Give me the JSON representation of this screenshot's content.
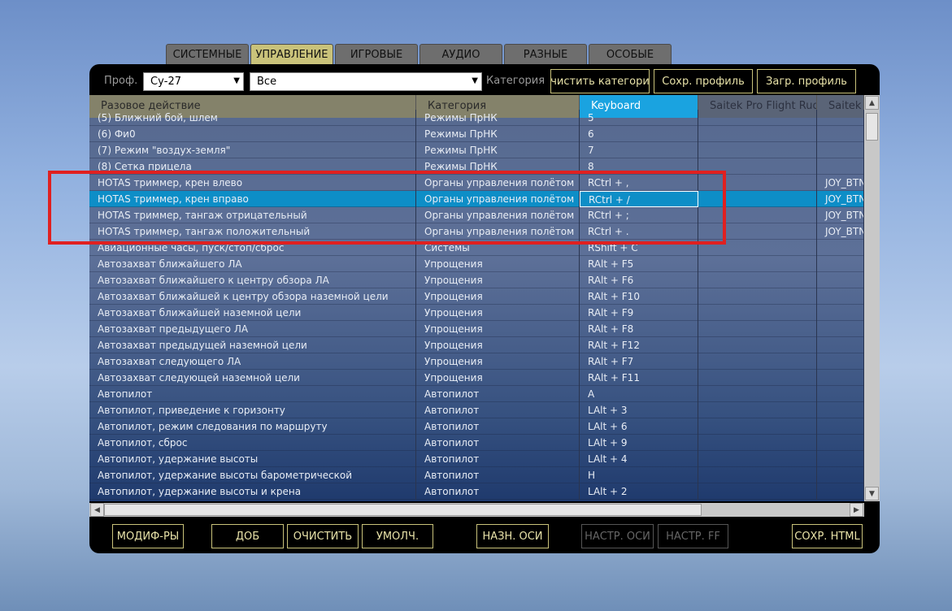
{
  "tabs": [
    "СИСТЕМНЫЕ",
    "УПРАВЛЕНИЕ",
    "ИГРОВЫЕ",
    "АУДИО",
    "РАЗНЫЕ",
    "ОСОБЫЕ"
  ],
  "toolbar": {
    "profile_label": "Проф.",
    "profile_value": "Су-27",
    "filter_value": "Все",
    "category_label": "Категория",
    "clear_category": "чистить категори",
    "save_profile": "Сохр. профиль",
    "load_profile": "Загр. профиль"
  },
  "columns": [
    "Разовое действие",
    "Категория",
    "Keyboard",
    "Saitek Pro Flight Rud",
    "Saitek"
  ],
  "rows": [
    {
      "action": "(5) Ближний бой, шлем",
      "category": "Режимы ПрНК",
      "kb": "5",
      "dev1": "",
      "dev2": ""
    },
    {
      "action": "(6) Фи0",
      "category": "Режимы ПрНК",
      "kb": "6",
      "dev1": "",
      "dev2": ""
    },
    {
      "action": "(7) Режим \"воздух-земля\"",
      "category": "Режимы ПрНК",
      "kb": "7",
      "dev1": "",
      "dev2": ""
    },
    {
      "action": "(8) Сетка прицела",
      "category": "Режимы ПрНК",
      "kb": "8",
      "dev1": "",
      "dev2": ""
    },
    {
      "action": "HOTAS триммер, крен влево",
      "category": "Органы управления полётом",
      "kb": "RCtrl + ,",
      "dev1": "",
      "dev2": "JOY_BTN_"
    },
    {
      "action": "HOTAS триммер, крен вправо",
      "category": "Органы управления полётом",
      "kb": "RCtrl + /",
      "dev1": "",
      "dev2": "JOY_BTN_"
    },
    {
      "action": "HOTAS триммер, тангаж отрицательный",
      "category": "Органы управления полётом",
      "kb": "RCtrl + ;",
      "dev1": "",
      "dev2": "JOY_BTN_"
    },
    {
      "action": "HOTAS триммер, тангаж положительный",
      "category": "Органы управления полётом",
      "kb": "RCtrl + .",
      "dev1": "",
      "dev2": "JOY_BTN_"
    },
    {
      "action": "Авиационные часы, пуск/стоп/сброс",
      "category": "Системы",
      "kb": "RShift + C",
      "dev1": "",
      "dev2": ""
    },
    {
      "action": "Автозахват ближайшего ЛА",
      "category": "Упрощения",
      "kb": "RAlt + F5",
      "dev1": "",
      "dev2": ""
    },
    {
      "action": "Автозахват ближайшего к центру обзора ЛА",
      "category": "Упрощения",
      "kb": "RAlt + F6",
      "dev1": "",
      "dev2": ""
    },
    {
      "action": "Автозахват ближайшей к центру обзора наземной цели",
      "category": "Упрощения",
      "kb": "RAlt + F10",
      "dev1": "",
      "dev2": ""
    },
    {
      "action": "Автозахват ближайшей наземной цели",
      "category": "Упрощения",
      "kb": "RAlt + F9",
      "dev1": "",
      "dev2": ""
    },
    {
      "action": "Автозахват предыдущего ЛА",
      "category": "Упрощения",
      "kb": "RAlt + F8",
      "dev1": "",
      "dev2": ""
    },
    {
      "action": "Автозахват предыдущей наземной цели",
      "category": "Упрощения",
      "kb": "RAlt + F12",
      "dev1": "",
      "dev2": ""
    },
    {
      "action": "Автозахват следующего ЛА",
      "category": "Упрощения",
      "kb": "RAlt + F7",
      "dev1": "",
      "dev2": ""
    },
    {
      "action": "Автозахват следующей наземной цели",
      "category": "Упрощения",
      "kb": "RAlt + F11",
      "dev1": "",
      "dev2": ""
    },
    {
      "action": "Автопилот",
      "category": "Автопилот",
      "kb": "A",
      "dev1": "",
      "dev2": ""
    },
    {
      "action": "Автопилот, приведение к горизонту",
      "category": "Автопилот",
      "kb": "LAlt + 3",
      "dev1": "",
      "dev2": ""
    },
    {
      "action": "Автопилот, режим следования по маршруту",
      "category": "Автопилот",
      "kb": "LAlt + 6",
      "dev1": "",
      "dev2": ""
    },
    {
      "action": "Автопилот, сброс",
      "category": "Автопилот",
      "kb": "LAlt + 9",
      "dev1": "",
      "dev2": ""
    },
    {
      "action": "Автопилот, удержание высоты",
      "category": "Автопилот",
      "kb": "LAlt + 4",
      "dev1": "",
      "dev2": ""
    },
    {
      "action": "Автопилот, удержание высоты барометрической",
      "category": "Автопилот",
      "kb": "H",
      "dev1": "",
      "dev2": ""
    },
    {
      "action": "Автопилот, удержание высоты и крена",
      "category": "Автопилот",
      "kb": "LAlt + 2",
      "dev1": "",
      "dev2": ""
    }
  ],
  "selected_row": 5,
  "bottom_buttons": {
    "modifiers": "МОДИФ-РЫ",
    "add": "ДОБ",
    "clear": "ОЧИСТИТЬ",
    "default": "УМОЛЧ.",
    "assign_axis": "НАЗН. ОСИ",
    "axis_setup": "НАСТР. ОСИ",
    "ff_setup": "НАСТР. FF",
    "save_html": "СОХР. HTML"
  },
  "colors": {
    "accent": "#c9c27a",
    "selected": "#0d8ec7",
    "keyboard_header": "#1aa3e0",
    "highlight_box": "#e02020"
  }
}
